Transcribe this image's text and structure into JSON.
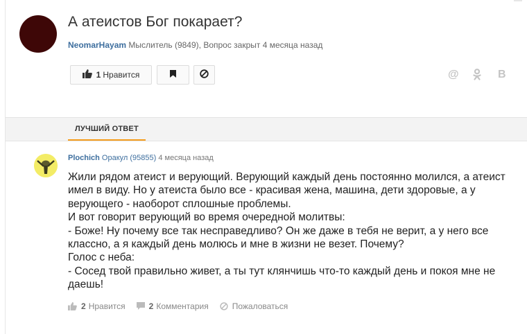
{
  "question": {
    "title": "А атеистов Бог покарает?",
    "author": "NeomarHayam",
    "rank_info": "Мыслитель (9849),",
    "status": "Вопрос закрыт 4 месяца назад",
    "like_count": "1",
    "like_label": "Нравится",
    "avatar_color": "#3e0707"
  },
  "share": {
    "at": "@",
    "ok": "ꝏ",
    "vk": "B"
  },
  "best_answer_tab": "ЛУЧШИЙ ОТВЕТ",
  "answer": {
    "author": "Plochich",
    "rank": "Оракул (95855)",
    "time": "4 месяца назад",
    "lines": [
      "Жили рядом атеист и верующий. Верующий каждый день постоянно молился, а атеист",
      "имел в виду. Но у атеиста было все - красивая жена, машина, дети здоровые, а у",
      "верующего - наоборот сплошные проблемы.",
      "И вот говорит верующий во время очередной молитвы:",
      "- Боже! Ну почему все так несправедливо? Он же даже в тебя не верит, а у него все",
      "классно, а я каждый день молюсь и мне в жизни не везет. Почему?",
      "Голос с неба:",
      "- Сосед твой правильно живет, а ты тут клянчишь что-то каждый день и покоя мне не",
      "даешь!"
    ],
    "likes_count": "2",
    "likes_label": "Нравится",
    "comments_count": "2",
    "comments_label": "Комментария",
    "report_label": "Пожаловаться"
  },
  "colors": {
    "link": "#3d6e9e",
    "accent": "#f59c1a"
  }
}
